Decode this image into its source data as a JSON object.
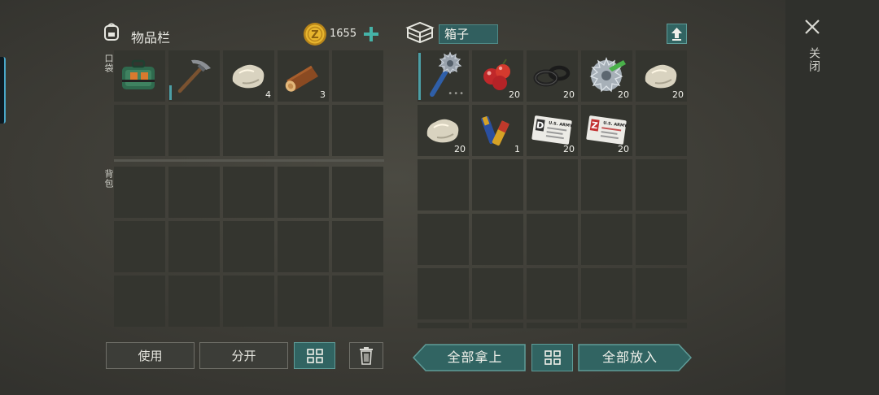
{
  "inventory": {
    "title": "物品栏",
    "coins": "1655",
    "pocket_label": "口袋",
    "backpack_label": "背包",
    "pocket_slots": [
      {
        "icon": "toolbox-icon",
        "qty": ""
      },
      {
        "icon": "pickaxe-icon",
        "qty": ""
      },
      {
        "icon": "stone-icon",
        "qty": "4"
      },
      {
        "icon": "log-icon",
        "qty": "3"
      },
      {
        "icon": "",
        "qty": ""
      },
      {
        "icon": "",
        "qty": ""
      },
      {
        "icon": "",
        "qty": ""
      },
      {
        "icon": "",
        "qty": ""
      },
      {
        "icon": "",
        "qty": ""
      },
      {
        "icon": "",
        "qty": ""
      }
    ],
    "backpack_slot_count": 15
  },
  "box": {
    "title": "箱子",
    "slots": [
      {
        "icon": "saw-club-icon",
        "qty": ""
      },
      {
        "icon": "berries-icon",
        "qty": "20"
      },
      {
        "icon": "rubber-rings-icon",
        "qty": "20"
      },
      {
        "icon": "saw-blade-icon",
        "qty": "20"
      },
      {
        "icon": "stone-icon",
        "qty": "20"
      },
      {
        "icon": "stone-icon",
        "qty": "20"
      },
      {
        "icon": "batteries-icon",
        "qty": "1"
      },
      {
        "icon": "army-id-card-d-icon",
        "qty": "20",
        "card_letter": "D",
        "card_text": "U.S. ARMY"
      },
      {
        "icon": "army-id-card-z-icon",
        "qty": "20",
        "card_letter": "Z",
        "card_text": "U.S. ARMY"
      }
    ],
    "slot_count": 30
  },
  "buttons": {
    "use": "使用",
    "split": "分开",
    "take_all": "全部拿上",
    "put_all": "全部放入"
  },
  "close_label": "关闭",
  "colors": {
    "teal": "#316462",
    "slot": "#34352f",
    "coin": "#d9a623",
    "plus": "#45b3a8"
  }
}
